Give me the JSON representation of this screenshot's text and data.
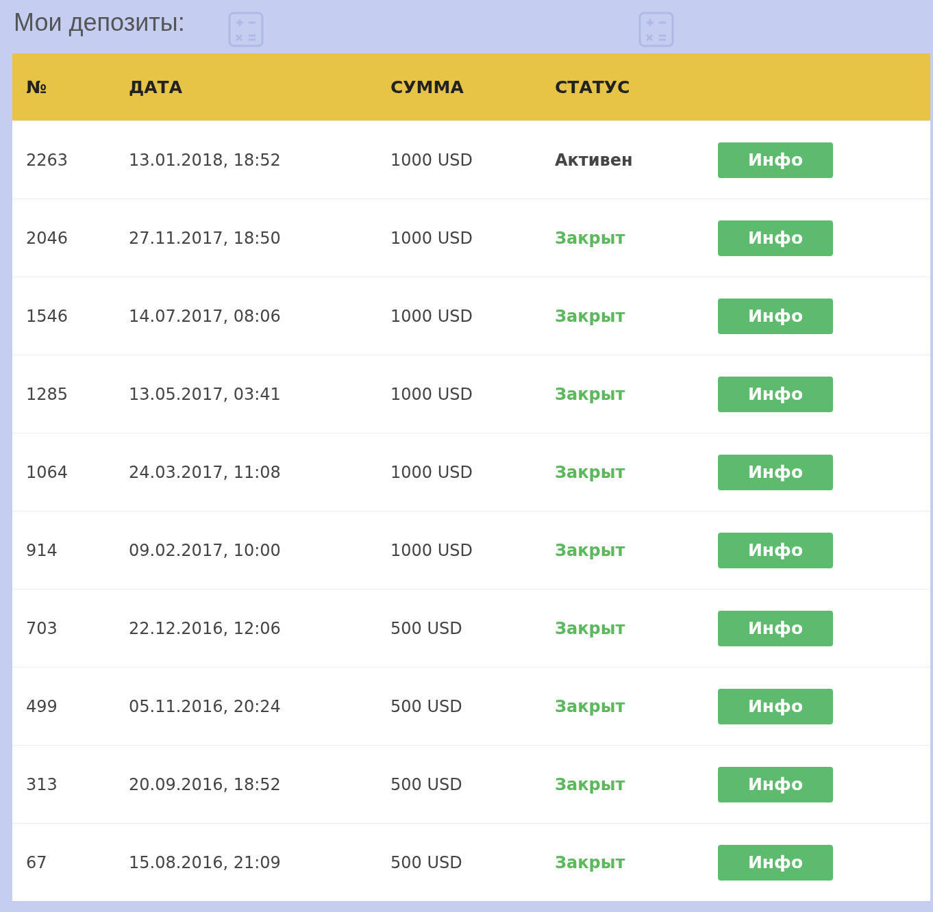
{
  "title": "Мои депозиты:",
  "table": {
    "columns": [
      "№",
      "ДАТА",
      "СУММА",
      "СТАТУС"
    ],
    "rows": [
      {
        "number": "2263",
        "date": "13.01.2018, 18:52",
        "amount": "1000 USD",
        "status": "Активен",
        "active": true,
        "button": "Инфо"
      },
      {
        "number": "2046",
        "date": "27.11.2017, 18:50",
        "amount": "1000 USD",
        "status": "Закрыт",
        "active": false,
        "button": "Инфо"
      },
      {
        "number": "1546",
        "date": "14.07.2017, 08:06",
        "amount": "1000 USD",
        "status": "Закрыт",
        "active": false,
        "button": "Инфо"
      },
      {
        "number": "1285",
        "date": "13.05.2017, 03:41",
        "amount": "1000 USD",
        "status": "Закрыт",
        "active": false,
        "button": "Инфо"
      },
      {
        "number": "1064",
        "date": "24.03.2017, 11:08",
        "amount": "1000 USD",
        "status": "Закрыт",
        "active": false,
        "button": "Инфо"
      },
      {
        "number": "914",
        "date": "09.02.2017, 10:00",
        "amount": "1000 USD",
        "status": "Закрыт",
        "active": false,
        "button": "Инфо"
      },
      {
        "number": "703",
        "date": "22.12.2016, 12:06",
        "amount": "500 USD",
        "status": "Закрыт",
        "active": false,
        "button": "Инфо"
      },
      {
        "number": "499",
        "date": "05.11.2016, 20:24",
        "amount": "500 USD",
        "status": "Закрыт",
        "active": false,
        "button": "Инфо"
      },
      {
        "number": "313",
        "date": "20.09.2016, 18:52",
        "amount": "500 USD",
        "status": "Закрыт",
        "active": false,
        "button": "Инфо"
      },
      {
        "number": "67",
        "date": "15.08.2016, 21:09",
        "amount": "500 USD",
        "status": "Закрыт",
        "active": false,
        "button": "Инфо"
      }
    ]
  }
}
